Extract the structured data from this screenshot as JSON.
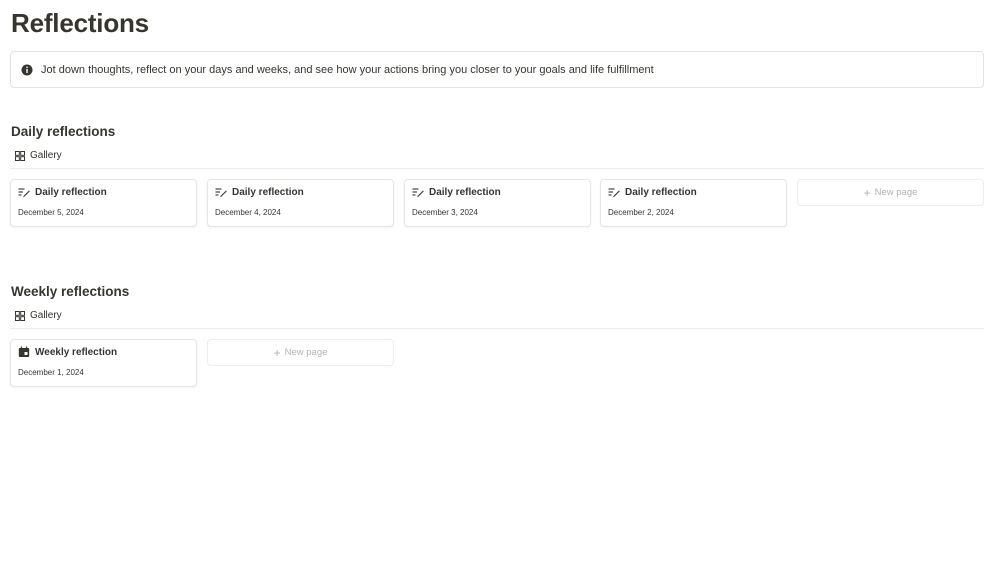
{
  "page": {
    "title": "Reflections"
  },
  "callout": {
    "icon": "info-icon",
    "text": "Jot down thoughts, reflect on your days and weeks, and see how your actions bring you closer to your goals and life fulfillment"
  },
  "daily": {
    "title": "Daily reflections",
    "view_label": "Gallery",
    "cards": [
      {
        "title": "Daily reflection",
        "date": "December 5, 2024",
        "icon": "note-edit-icon"
      },
      {
        "title": "Daily reflection",
        "date": "December 4, 2024",
        "icon": "note-edit-icon"
      },
      {
        "title": "Daily reflection",
        "date": "December 3, 2024",
        "icon": "note-edit-icon"
      },
      {
        "title": "Daily reflection",
        "date": "December 2, 2024",
        "icon": "note-edit-icon"
      }
    ],
    "new_page_label": "New page"
  },
  "weekly": {
    "title": "Weekly reflections",
    "view_label": "Gallery",
    "cards": [
      {
        "title": "Weekly reflection",
        "date": "December 1, 2024",
        "icon": "calendar-icon"
      }
    ],
    "new_page_label": "New page"
  },
  "colors": {
    "text": "#37352f",
    "border": "#e6e5e3",
    "muted": "#b4b3b0"
  }
}
